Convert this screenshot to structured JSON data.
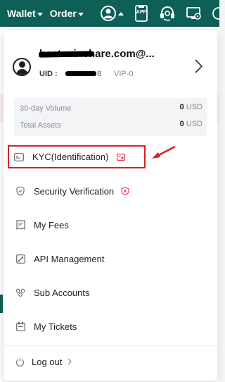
{
  "topbar": {
    "wallet_label": "Wallet",
    "order_label": "Order",
    "app_label": "APP",
    "bg_color": "#0e5f56"
  },
  "user": {
    "email": "bestcoinshare.com@...",
    "uid_label": "UID :",
    "uid_value": "8",
    "vip_level": "VIP-0"
  },
  "stats": [
    {
      "label": "30-day Volume",
      "value": "0",
      "unit": "USD"
    },
    {
      "label": "Total Assets",
      "value": "0",
      "unit": "USD"
    }
  ],
  "menu": {
    "kyc": "KYC(Identification)",
    "security": "Security Verification",
    "fees": "My Fees",
    "api": "API Management",
    "sub_accounts": "Sub Accounts",
    "tickets": "My Tickets",
    "logout": "Log out"
  },
  "colors": {
    "highlight": "#d91e26",
    "accent": "#0e5f56",
    "badge": "#e0394f"
  }
}
